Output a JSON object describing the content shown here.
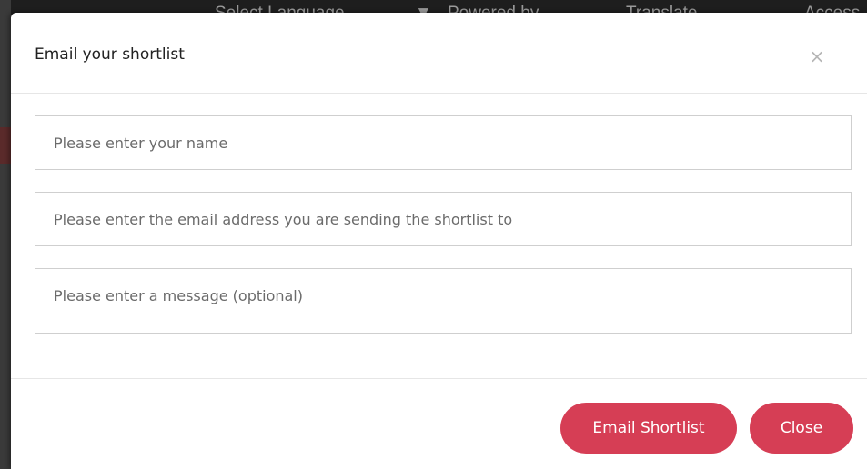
{
  "background": {
    "items": [
      "Select Language",
      "▼",
      "Powered by",
      "Translate",
      "Access"
    ]
  },
  "modal": {
    "title": "Email your shortlist",
    "close_icon": "×",
    "fields": {
      "name_placeholder": "Please enter your name",
      "email_placeholder": "Please enter the email address you are sending the shortlist to",
      "message_placeholder": "Please enter a message (optional)"
    },
    "buttons": {
      "email_label": "Email Shortlist",
      "close_label": "Close"
    }
  },
  "colors": {
    "accent": "#d63e55",
    "border": "#cfcfcf"
  }
}
